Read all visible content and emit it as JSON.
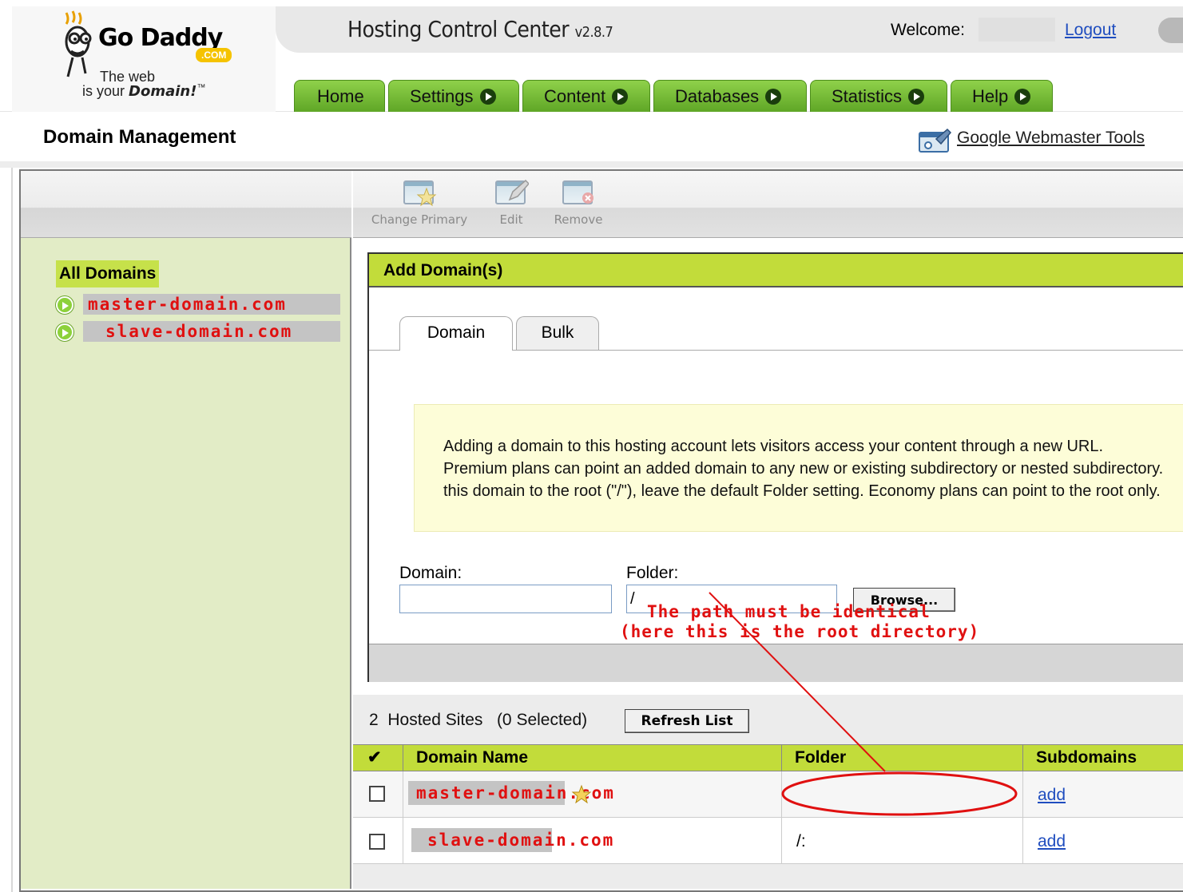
{
  "header": {
    "logo_brand": "Go Daddy",
    "logo_dotcom": ".COM",
    "logo_tagline_1": "The web",
    "logo_tagline_2": "is your",
    "logo_tagline_3": "Domain!",
    "logo_tm": "™",
    "app_title": "Hosting Control Center",
    "app_version": "v2.8.7",
    "welcome_label": "Welcome:",
    "logout_label": "Logout"
  },
  "nav": {
    "tabs": [
      {
        "label": "Home"
      },
      {
        "label": "Settings"
      },
      {
        "label": "Content"
      },
      {
        "label": "Databases"
      },
      {
        "label": "Statistics"
      },
      {
        "label": "Help"
      }
    ]
  },
  "page": {
    "title": "Domain Management",
    "webmaster_link": "Google Webmaster Tools"
  },
  "sidebar": {
    "all_domains": "All Domains",
    "domains": [
      {
        "name": "master-domain.com"
      },
      {
        "name": "slave-domain.com"
      }
    ]
  },
  "toolbar": {
    "change_primary": "Change Primary",
    "edit": "Edit",
    "remove": "Remove"
  },
  "add_panel": {
    "title": "Add Domain(s)",
    "tab_domain": "Domain",
    "tab_bulk": "Bulk",
    "notice_line_1": "Adding a domain to this hosting account lets visitors access your content through a new URL.",
    "notice_line_2": "Premium plans can point an added domain to any new or existing subdirectory or nested subdirectory.",
    "notice_line_3": "this domain to the root (\"/\"), leave the default Folder setting. Economy plans can point to the root only.",
    "domain_label": "Domain:",
    "domain_value": "",
    "folder_label": "Folder:",
    "folder_value": "/",
    "browse_label": "Browse..."
  },
  "hosted": {
    "count": "2",
    "count_label": "Hosted Sites",
    "selected_label": "(0 Selected)",
    "refresh_label": "Refresh List",
    "check_header": "✔",
    "columns": {
      "domain_name": "Domain Name",
      "folder": "Folder",
      "subdomains": "Subdomains"
    },
    "rows": [
      {
        "domain": "master-domain.com",
        "folder": "",
        "subdomains": "add",
        "primary": true
      },
      {
        "domain": "slave-domain.com",
        "folder": "/:",
        "subdomains": "add",
        "primary": false
      }
    ]
  },
  "annotation": {
    "line_1": "The path must be identical",
    "line_2": "(here this is the root directory)",
    "color": "#e01010"
  }
}
